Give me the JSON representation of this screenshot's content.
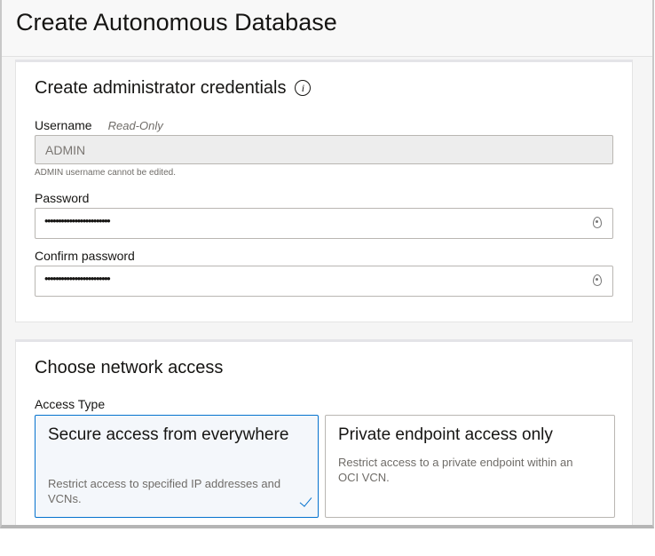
{
  "header": {
    "title": "Create Autonomous Database"
  },
  "credentials": {
    "title": "Create administrator credentials",
    "info_icon": "info-icon",
    "username_label": "Username",
    "username_badge": "Read-Only",
    "username_value": "ADMIN",
    "username_help": "ADMIN username cannot be edited.",
    "password_label": "Password",
    "password_value": "••••••••••••••••••••••••",
    "confirm_label": "Confirm password",
    "confirm_value": "••••••••••••••••••••••••"
  },
  "network": {
    "title": "Choose network access",
    "access_type_label": "Access Type",
    "options": [
      {
        "title": "Secure access from everywhere",
        "description": "Restrict access to specified IP addresses and VCNs.",
        "selected": true
      },
      {
        "title": "Private endpoint access only",
        "description": "Restrict access to a private endpoint within an OCI VCN.",
        "selected": false
      }
    ]
  },
  "colors": {
    "accent": "#0572ce"
  }
}
